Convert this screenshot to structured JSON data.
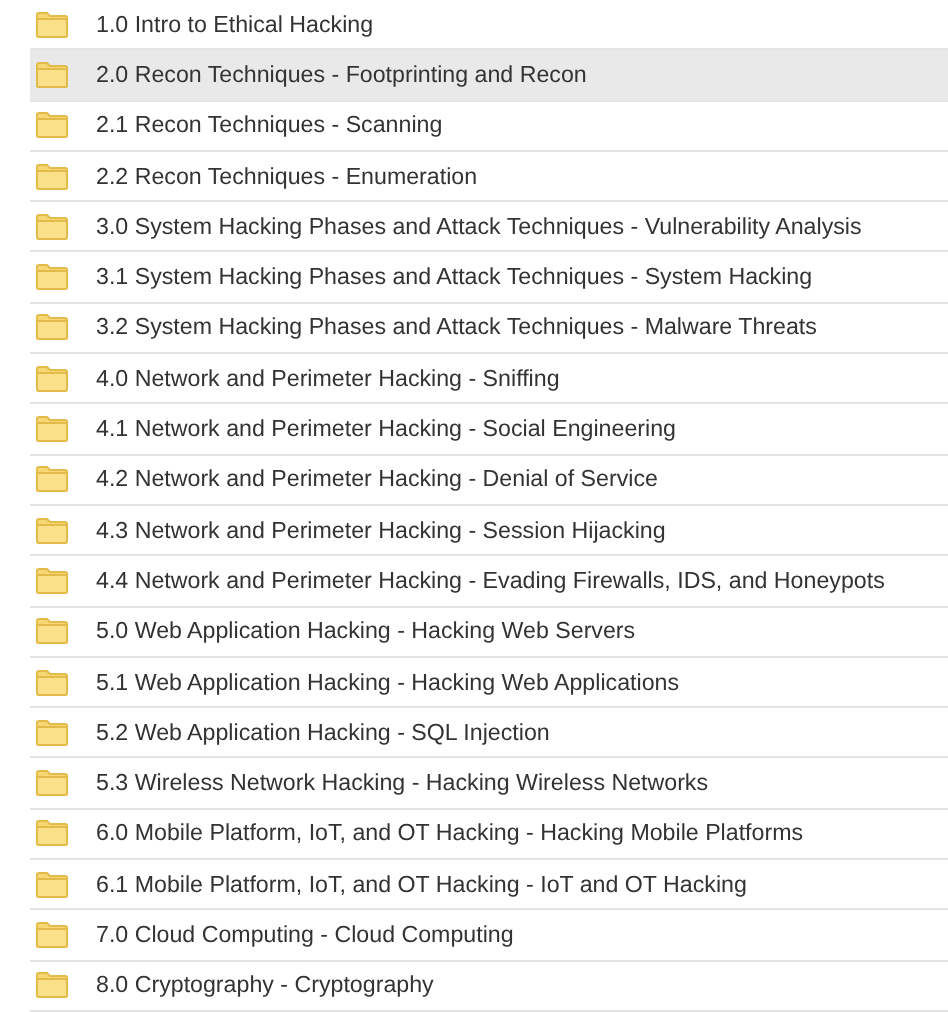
{
  "folders": [
    {
      "name": "1.0 Intro to Ethical Hacking",
      "selected": false
    },
    {
      "name": "2.0 Recon Techniques - Footprinting and Recon",
      "selected": true
    },
    {
      "name": "2.1 Recon Techniques - Scanning",
      "selected": false
    },
    {
      "name": "2.2 Recon Techniques - Enumeration",
      "selected": false
    },
    {
      "name": "3.0 System Hacking Phases and Attack Techniques - Vulnerability Analysis",
      "selected": false
    },
    {
      "name": "3.1 System Hacking Phases and Attack Techniques - System Hacking",
      "selected": false
    },
    {
      "name": "3.2 System Hacking Phases and Attack Techniques - Malware Threats",
      "selected": false
    },
    {
      "name": "4.0 Network and Perimeter Hacking - Sniffing",
      "selected": false
    },
    {
      "name": "4.1 Network and Perimeter Hacking - Social Engineering",
      "selected": false
    },
    {
      "name": "4.2 Network and Perimeter Hacking - Denial of Service",
      "selected": false
    },
    {
      "name": "4.3 Network and Perimeter Hacking - Session Hijacking",
      "selected": false
    },
    {
      "name": "4.4 Network and Perimeter Hacking - Evading Firewalls, IDS, and Honeypots",
      "selected": false
    },
    {
      "name": "5.0 Web Application Hacking - Hacking Web Servers",
      "selected": false
    },
    {
      "name": "5.1 Web Application Hacking - Hacking Web Applications",
      "selected": false
    },
    {
      "name": "5.2 Web Application Hacking - SQL Injection",
      "selected": false
    },
    {
      "name": "5.3 Wireless Network Hacking - Hacking Wireless Networks",
      "selected": false
    },
    {
      "name": "6.0 Mobile Platform, IoT, and OT Hacking - Hacking Mobile Platforms",
      "selected": false
    },
    {
      "name": "6.1 Mobile Platform, IoT, and OT Hacking - IoT and OT Hacking",
      "selected": false
    },
    {
      "name": "7.0 Cloud Computing - Cloud Computing",
      "selected": false
    },
    {
      "name": "8.0 Cryptography - Cryptography",
      "selected": false
    }
  ]
}
